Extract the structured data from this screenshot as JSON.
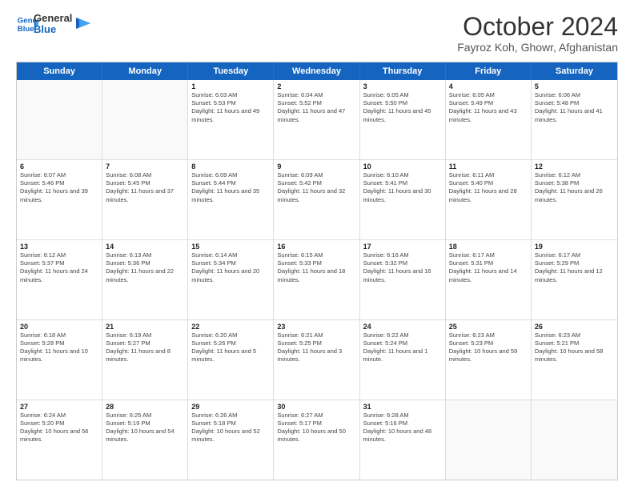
{
  "header": {
    "logo_line1": "General",
    "logo_line2": "Blue",
    "month": "October 2024",
    "location": "Fayroz Koh, Ghowr, Afghanistan"
  },
  "days": [
    "Sunday",
    "Monday",
    "Tuesday",
    "Wednesday",
    "Thursday",
    "Friday",
    "Saturday"
  ],
  "weeks": [
    [
      {
        "date": "",
        "sunrise": "",
        "sunset": "",
        "daylight": ""
      },
      {
        "date": "",
        "sunrise": "",
        "sunset": "",
        "daylight": ""
      },
      {
        "date": "1",
        "sunrise": "Sunrise: 6:03 AM",
        "sunset": "Sunset: 5:53 PM",
        "daylight": "Daylight: 11 hours and 49 minutes."
      },
      {
        "date": "2",
        "sunrise": "Sunrise: 6:04 AM",
        "sunset": "Sunset: 5:52 PM",
        "daylight": "Daylight: 11 hours and 47 minutes."
      },
      {
        "date": "3",
        "sunrise": "Sunrise: 6:05 AM",
        "sunset": "Sunset: 5:50 PM",
        "daylight": "Daylight: 11 hours and 45 minutes."
      },
      {
        "date": "4",
        "sunrise": "Sunrise: 6:05 AM",
        "sunset": "Sunset: 5:49 PM",
        "daylight": "Daylight: 11 hours and 43 minutes."
      },
      {
        "date": "5",
        "sunrise": "Sunrise: 6:06 AM",
        "sunset": "Sunset: 5:48 PM",
        "daylight": "Daylight: 11 hours and 41 minutes."
      }
    ],
    [
      {
        "date": "6",
        "sunrise": "Sunrise: 6:07 AM",
        "sunset": "Sunset: 5:46 PM",
        "daylight": "Daylight: 11 hours and 39 minutes."
      },
      {
        "date": "7",
        "sunrise": "Sunrise: 6:08 AM",
        "sunset": "Sunset: 5:45 PM",
        "daylight": "Daylight: 11 hours and 37 minutes."
      },
      {
        "date": "8",
        "sunrise": "Sunrise: 6:09 AM",
        "sunset": "Sunset: 5:44 PM",
        "daylight": "Daylight: 11 hours and 35 minutes."
      },
      {
        "date": "9",
        "sunrise": "Sunrise: 6:09 AM",
        "sunset": "Sunset: 5:42 PM",
        "daylight": "Daylight: 11 hours and 32 minutes."
      },
      {
        "date": "10",
        "sunrise": "Sunrise: 6:10 AM",
        "sunset": "Sunset: 5:41 PM",
        "daylight": "Daylight: 11 hours and 30 minutes."
      },
      {
        "date": "11",
        "sunrise": "Sunrise: 6:11 AM",
        "sunset": "Sunset: 5:40 PM",
        "daylight": "Daylight: 11 hours and 28 minutes."
      },
      {
        "date": "12",
        "sunrise": "Sunrise: 6:12 AM",
        "sunset": "Sunset: 5:38 PM",
        "daylight": "Daylight: 11 hours and 26 minutes."
      }
    ],
    [
      {
        "date": "13",
        "sunrise": "Sunrise: 6:12 AM",
        "sunset": "Sunset: 5:37 PM",
        "daylight": "Daylight: 11 hours and 24 minutes."
      },
      {
        "date": "14",
        "sunrise": "Sunrise: 6:13 AM",
        "sunset": "Sunset: 5:36 PM",
        "daylight": "Daylight: 11 hours and 22 minutes."
      },
      {
        "date": "15",
        "sunrise": "Sunrise: 6:14 AM",
        "sunset": "Sunset: 5:34 PM",
        "daylight": "Daylight: 11 hours and 20 minutes."
      },
      {
        "date": "16",
        "sunrise": "Sunrise: 6:15 AM",
        "sunset": "Sunset: 5:33 PM",
        "daylight": "Daylight: 11 hours and 18 minutes."
      },
      {
        "date": "17",
        "sunrise": "Sunrise: 6:16 AM",
        "sunset": "Sunset: 5:32 PM",
        "daylight": "Daylight: 11 hours and 16 minutes."
      },
      {
        "date": "18",
        "sunrise": "Sunrise: 6:17 AM",
        "sunset": "Sunset: 5:31 PM",
        "daylight": "Daylight: 11 hours and 14 minutes."
      },
      {
        "date": "19",
        "sunrise": "Sunrise: 6:17 AM",
        "sunset": "Sunset: 5:29 PM",
        "daylight": "Daylight: 11 hours and 12 minutes."
      }
    ],
    [
      {
        "date": "20",
        "sunrise": "Sunrise: 6:18 AM",
        "sunset": "Sunset: 5:28 PM",
        "daylight": "Daylight: 11 hours and 10 minutes."
      },
      {
        "date": "21",
        "sunrise": "Sunrise: 6:19 AM",
        "sunset": "Sunset: 5:27 PM",
        "daylight": "Daylight: 11 hours and 8 minutes."
      },
      {
        "date": "22",
        "sunrise": "Sunrise: 6:20 AM",
        "sunset": "Sunset: 5:26 PM",
        "daylight": "Daylight: 11 hours and 5 minutes."
      },
      {
        "date": "23",
        "sunrise": "Sunrise: 6:21 AM",
        "sunset": "Sunset: 5:25 PM",
        "daylight": "Daylight: 11 hours and 3 minutes."
      },
      {
        "date": "24",
        "sunrise": "Sunrise: 6:22 AM",
        "sunset": "Sunset: 5:24 PM",
        "daylight": "Daylight: 11 hours and 1 minute."
      },
      {
        "date": "25",
        "sunrise": "Sunrise: 6:23 AM",
        "sunset": "Sunset: 5:23 PM",
        "daylight": "Daylight: 10 hours and 59 minutes."
      },
      {
        "date": "26",
        "sunrise": "Sunrise: 6:23 AM",
        "sunset": "Sunset: 5:21 PM",
        "daylight": "Daylight: 10 hours and 58 minutes."
      }
    ],
    [
      {
        "date": "27",
        "sunrise": "Sunrise: 6:24 AM",
        "sunset": "Sunset: 5:20 PM",
        "daylight": "Daylight: 10 hours and 56 minutes."
      },
      {
        "date": "28",
        "sunrise": "Sunrise: 6:25 AM",
        "sunset": "Sunset: 5:19 PM",
        "daylight": "Daylight: 10 hours and 54 minutes."
      },
      {
        "date": "29",
        "sunrise": "Sunrise: 6:26 AM",
        "sunset": "Sunset: 5:18 PM",
        "daylight": "Daylight: 10 hours and 52 minutes."
      },
      {
        "date": "30",
        "sunrise": "Sunrise: 6:27 AM",
        "sunset": "Sunset: 5:17 PM",
        "daylight": "Daylight: 10 hours and 50 minutes."
      },
      {
        "date": "31",
        "sunrise": "Sunrise: 6:28 AM",
        "sunset": "Sunset: 5:16 PM",
        "daylight": "Daylight: 10 hours and 48 minutes."
      },
      {
        "date": "",
        "sunrise": "",
        "sunset": "",
        "daylight": ""
      },
      {
        "date": "",
        "sunrise": "",
        "sunset": "",
        "daylight": ""
      }
    ]
  ]
}
